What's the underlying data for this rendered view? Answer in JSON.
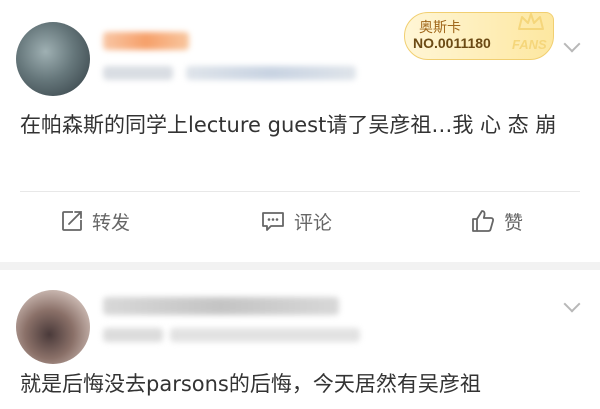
{
  "posts": [
    {
      "fan_badge": {
        "title": "奥斯卡",
        "number": "NO.0011180",
        "fans_label": "FANS"
      },
      "text": "在帕森斯的同学上lecture guest请了吴彦祖…我 心 态 崩",
      "actions": {
        "repost": "转发",
        "comment": "评论",
        "like": "赞"
      }
    },
    {
      "text": "就是后悔没去parsons的后悔，今天居然有吴彦祖"
    }
  ],
  "colors": {
    "background": "#f2f2f2",
    "card": "#ffffff",
    "text": "#333333",
    "action_text": "#666666",
    "badge_gold": "#f1cf71"
  },
  "icons": [
    "repost-icon",
    "comment-icon",
    "like-icon",
    "chevron-down-icon",
    "crown-icon"
  ]
}
